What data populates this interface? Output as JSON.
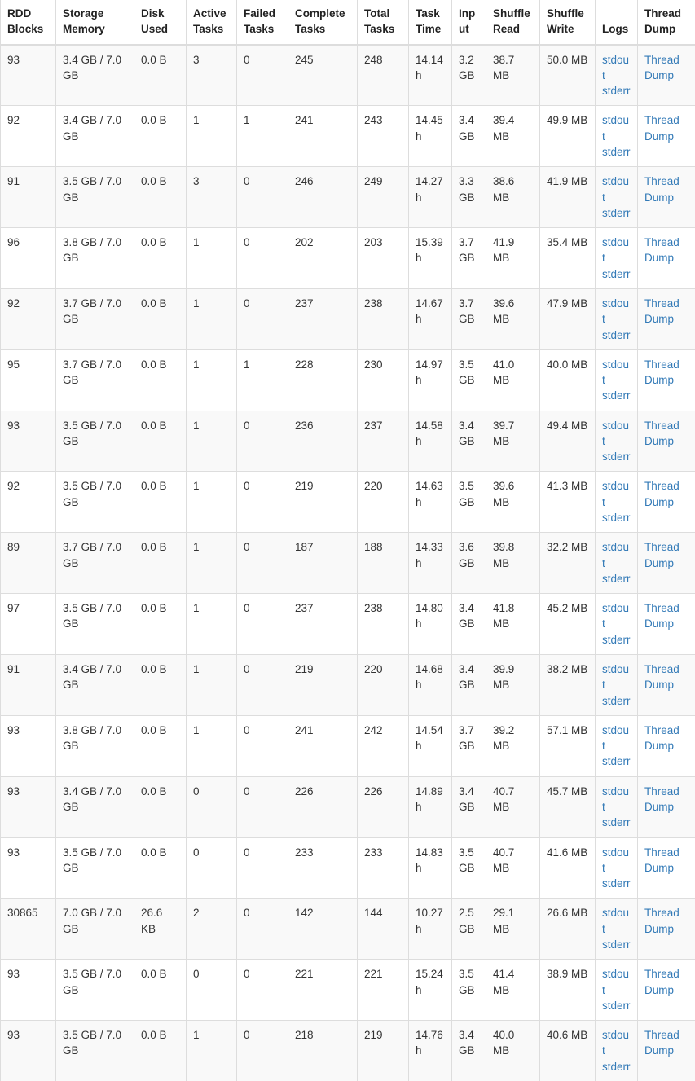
{
  "table": {
    "columns": [
      {
        "key": "rdd_blocks",
        "label": "RDD Blocks",
        "class": "c-rdd"
      },
      {
        "key": "storage_memory",
        "label": "Storage Memory",
        "class": "c-storage"
      },
      {
        "key": "disk_used",
        "label": "Disk Used",
        "class": "c-disk"
      },
      {
        "key": "active_tasks",
        "label": "Active Tasks",
        "class": "c-active"
      },
      {
        "key": "failed_tasks",
        "label": "Failed Tasks",
        "class": "c-failed"
      },
      {
        "key": "complete_tasks",
        "label": "Complete Tasks",
        "class": "c-complete"
      },
      {
        "key": "total_tasks",
        "label": "Total Tasks",
        "class": "c-total"
      },
      {
        "key": "task_time",
        "label": "Task Time",
        "class": "c-tasktime"
      },
      {
        "key": "input",
        "label": "Input",
        "class": "c-input"
      },
      {
        "key": "shuffle_read",
        "label": "Shuffle Read",
        "class": "c-sread"
      },
      {
        "key": "shuffle_write",
        "label": "Shuffle Write",
        "class": "c-swrite"
      },
      {
        "key": "logs",
        "label": "Logs",
        "class": "c-logs"
      },
      {
        "key": "thread_dump",
        "label": "Thread Dump",
        "class": "c-thread"
      }
    ],
    "log_links": [
      "stdout",
      "stderr"
    ],
    "thread_dump_link": "Thread Dump",
    "link_color": "#337ab7",
    "stripe_color": "#f9f9f9",
    "border_color": "#dddddd",
    "rows": [
      {
        "rdd_blocks": "93",
        "storage_memory": "3.4 GB / 7.0 GB",
        "disk_used": "0.0 B",
        "active_tasks": "3",
        "failed_tasks": "0",
        "complete_tasks": "245",
        "total_tasks": "248",
        "task_time": "14.14 h",
        "input": "3.2 GB",
        "shuffle_read": "38.7 MB",
        "shuffle_write": "50.0 MB"
      },
      {
        "rdd_blocks": "92",
        "storage_memory": "3.4 GB / 7.0 GB",
        "disk_used": "0.0 B",
        "active_tasks": "1",
        "failed_tasks": "1",
        "complete_tasks": "241",
        "total_tasks": "243",
        "task_time": "14.45 h",
        "input": "3.4 GB",
        "shuffle_read": "39.4 MB",
        "shuffle_write": "49.9 MB"
      },
      {
        "rdd_blocks": "91",
        "storage_memory": "3.5 GB / 7.0 GB",
        "disk_used": "0.0 B",
        "active_tasks": "3",
        "failed_tasks": "0",
        "complete_tasks": "246",
        "total_tasks": "249",
        "task_time": "14.27 h",
        "input": "3.3 GB",
        "shuffle_read": "38.6 MB",
        "shuffle_write": "41.9 MB"
      },
      {
        "rdd_blocks": "96",
        "storage_memory": "3.8 GB / 7.0 GB",
        "disk_used": "0.0 B",
        "active_tasks": "1",
        "failed_tasks": "0",
        "complete_tasks": "202",
        "total_tasks": "203",
        "task_time": "15.39 h",
        "input": "3.7 GB",
        "shuffle_read": "41.9 MB",
        "shuffle_write": "35.4 MB"
      },
      {
        "rdd_blocks": "92",
        "storage_memory": "3.7 GB / 7.0 GB",
        "disk_used": "0.0 B",
        "active_tasks": "1",
        "failed_tasks": "0",
        "complete_tasks": "237",
        "total_tasks": "238",
        "task_time": "14.67 h",
        "input": "3.7 GB",
        "shuffle_read": "39.6 MB",
        "shuffle_write": "47.9 MB"
      },
      {
        "rdd_blocks": "95",
        "storage_memory": "3.7 GB / 7.0 GB",
        "disk_used": "0.0 B",
        "active_tasks": "1",
        "failed_tasks": "1",
        "complete_tasks": "228",
        "total_tasks": "230",
        "task_time": "14.97 h",
        "input": "3.5 GB",
        "shuffle_read": "41.0 MB",
        "shuffle_write": "40.0 MB"
      },
      {
        "rdd_blocks": "93",
        "storage_memory": "3.5 GB / 7.0 GB",
        "disk_used": "0.0 B",
        "active_tasks": "1",
        "failed_tasks": "0",
        "complete_tasks": "236",
        "total_tasks": "237",
        "task_time": "14.58 h",
        "input": "3.4 GB",
        "shuffle_read": "39.7 MB",
        "shuffle_write": "49.4 MB"
      },
      {
        "rdd_blocks": "92",
        "storage_memory": "3.5 GB / 7.0 GB",
        "disk_used": "0.0 B",
        "active_tasks": "1",
        "failed_tasks": "0",
        "complete_tasks": "219",
        "total_tasks": "220",
        "task_time": "14.63 h",
        "input": "3.5 GB",
        "shuffle_read": "39.6 MB",
        "shuffle_write": "41.3 MB"
      },
      {
        "rdd_blocks": "89",
        "storage_memory": "3.7 GB / 7.0 GB",
        "disk_used": "0.0 B",
        "active_tasks": "1",
        "failed_tasks": "0",
        "complete_tasks": "187",
        "total_tasks": "188",
        "task_time": "14.33 h",
        "input": "3.6 GB",
        "shuffle_read": "39.8 MB",
        "shuffle_write": "32.2 MB"
      },
      {
        "rdd_blocks": "97",
        "storage_memory": "3.5 GB / 7.0 GB",
        "disk_used": "0.0 B",
        "active_tasks": "1",
        "failed_tasks": "0",
        "complete_tasks": "237",
        "total_tasks": "238",
        "task_time": "14.80 h",
        "input": "3.4 GB",
        "shuffle_read": "41.8 MB",
        "shuffle_write": "45.2 MB"
      },
      {
        "rdd_blocks": "91",
        "storage_memory": "3.4 GB / 7.0 GB",
        "disk_used": "0.0 B",
        "active_tasks": "1",
        "failed_tasks": "0",
        "complete_tasks": "219",
        "total_tasks": "220",
        "task_time": "14.68 h",
        "input": "3.4 GB",
        "shuffle_read": "39.9 MB",
        "shuffle_write": "38.2 MB"
      },
      {
        "rdd_blocks": "93",
        "storage_memory": "3.8 GB / 7.0 GB",
        "disk_used": "0.0 B",
        "active_tasks": "1",
        "failed_tasks": "0",
        "complete_tasks": "241",
        "total_tasks": "242",
        "task_time": "14.54 h",
        "input": "3.7 GB",
        "shuffle_read": "39.2 MB",
        "shuffle_write": "57.1 MB"
      },
      {
        "rdd_blocks": "93",
        "storage_memory": "3.4 GB / 7.0 GB",
        "disk_used": "0.0 B",
        "active_tasks": "0",
        "failed_tasks": "0",
        "complete_tasks": "226",
        "total_tasks": "226",
        "task_time": "14.89 h",
        "input": "3.4 GB",
        "shuffle_read": "40.7 MB",
        "shuffle_write": "45.7 MB"
      },
      {
        "rdd_blocks": "93",
        "storage_memory": "3.5 GB / 7.0 GB",
        "disk_used": "0.0 B",
        "active_tasks": "0",
        "failed_tasks": "0",
        "complete_tasks": "233",
        "total_tasks": "233",
        "task_time": "14.83 h",
        "input": "3.5 GB",
        "shuffle_read": "40.7 MB",
        "shuffle_write": "41.6 MB"
      },
      {
        "rdd_blocks": "30865",
        "storage_memory": "7.0 GB / 7.0 GB",
        "disk_used": "26.6 KB",
        "active_tasks": "2",
        "failed_tasks": "0",
        "complete_tasks": "142",
        "total_tasks": "144",
        "task_time": "10.27 h",
        "input": "2.5 GB",
        "shuffle_read": "29.1 MB",
        "shuffle_write": "26.6 MB"
      },
      {
        "rdd_blocks": "93",
        "storage_memory": "3.5 GB / 7.0 GB",
        "disk_used": "0.0 B",
        "active_tasks": "0",
        "failed_tasks": "0",
        "complete_tasks": "221",
        "total_tasks": "221",
        "task_time": "15.24 h",
        "input": "3.5 GB",
        "shuffle_read": "41.4 MB",
        "shuffle_write": "38.9 MB"
      },
      {
        "rdd_blocks": "93",
        "storage_memory": "3.5 GB / 7.0 GB",
        "disk_used": "0.0 B",
        "active_tasks": "1",
        "failed_tasks": "0",
        "complete_tasks": "218",
        "total_tasks": "219",
        "task_time": "14.76 h",
        "input": "3.4 GB",
        "shuffle_read": "40.0 MB",
        "shuffle_write": "40.6 MB"
      }
    ]
  }
}
